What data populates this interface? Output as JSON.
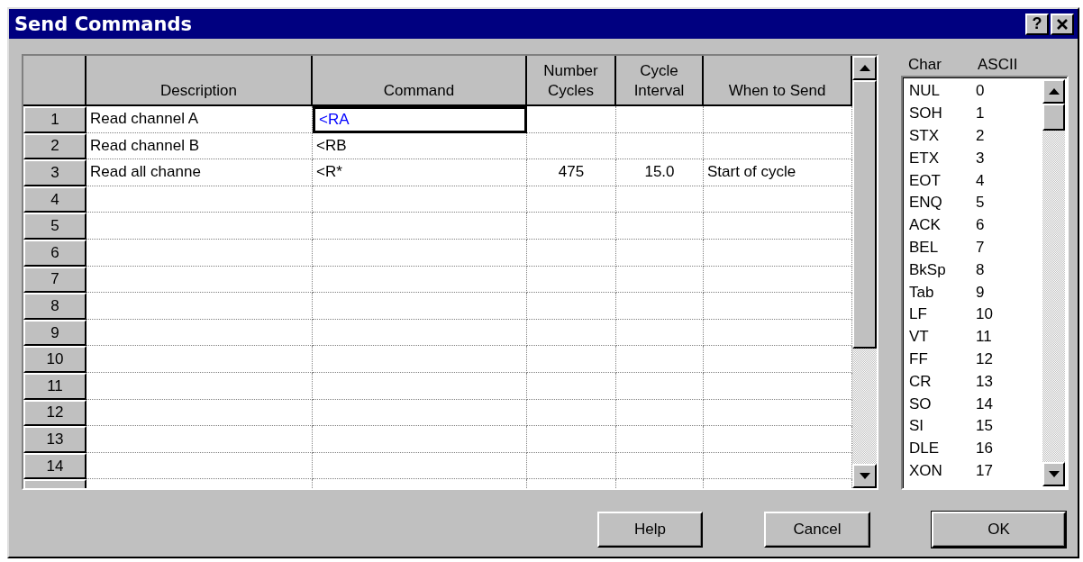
{
  "window": {
    "title": "Send Commands",
    "help_button": "?"
  },
  "table": {
    "columns": [
      "Description",
      "Command",
      "Number Cycles",
      "Cycle Interval",
      "When to Send"
    ],
    "rows": [
      {
        "number": "1",
        "description": "Read channel A",
        "command": "<RA",
        "selected": true
      },
      {
        "number": "2",
        "description": "Read channel B",
        "command": "<RB",
        "selected": false
      },
      {
        "number": "3",
        "description": "Read all channe",
        "command": "<R*",
        "cycles": "475",
        "interval": "15.0",
        "when": "Start of cycle",
        "selected": false
      },
      {
        "number": "4",
        "selected": false
      },
      {
        "number": "5",
        "selected": false
      },
      {
        "number": "6",
        "selected": false
      },
      {
        "number": "7",
        "selected": false
      },
      {
        "number": "8",
        "selected": false
      },
      {
        "number": "9",
        "selected": false
      },
      {
        "number": "10",
        "selected": false
      },
      {
        "number": "11",
        "selected": false
      },
      {
        "number": "12",
        "selected": false
      },
      {
        "number": "13",
        "selected": false
      },
      {
        "number": "14",
        "selected": false
      }
    ]
  },
  "char_list": {
    "headers": [
      "Char",
      "ASCII"
    ],
    "items": [
      {
        "char": "NUL",
        "code": "0"
      },
      {
        "char": "SOH",
        "code": "1"
      },
      {
        "char": "STX",
        "code": "2"
      },
      {
        "char": "ETX",
        "code": "3"
      },
      {
        "char": "EOT",
        "code": "4"
      },
      {
        "char": "ENQ",
        "code": "5"
      },
      {
        "char": "ACK",
        "code": "6"
      },
      {
        "char": "BEL",
        "code": "7"
      },
      {
        "char": "BkSp",
        "code": "8"
      },
      {
        "char": "Tab",
        "code": "9"
      },
      {
        "char": "LF",
        "code": "10"
      },
      {
        "char": "VT",
        "code": "11"
      },
      {
        "char": "FF",
        "code": "12"
      },
      {
        "char": "CR",
        "code": "13"
      },
      {
        "char": "SO",
        "code": "14"
      },
      {
        "char": "SI",
        "code": "15"
      },
      {
        "char": "DLE",
        "code": "16"
      },
      {
        "char": "XON",
        "code": "17"
      }
    ]
  },
  "buttons": [
    {
      "label": "Help",
      "default": false
    },
    {
      "label": "Cancel",
      "default": false
    },
    {
      "label": "OK",
      "default": true
    }
  ]
}
